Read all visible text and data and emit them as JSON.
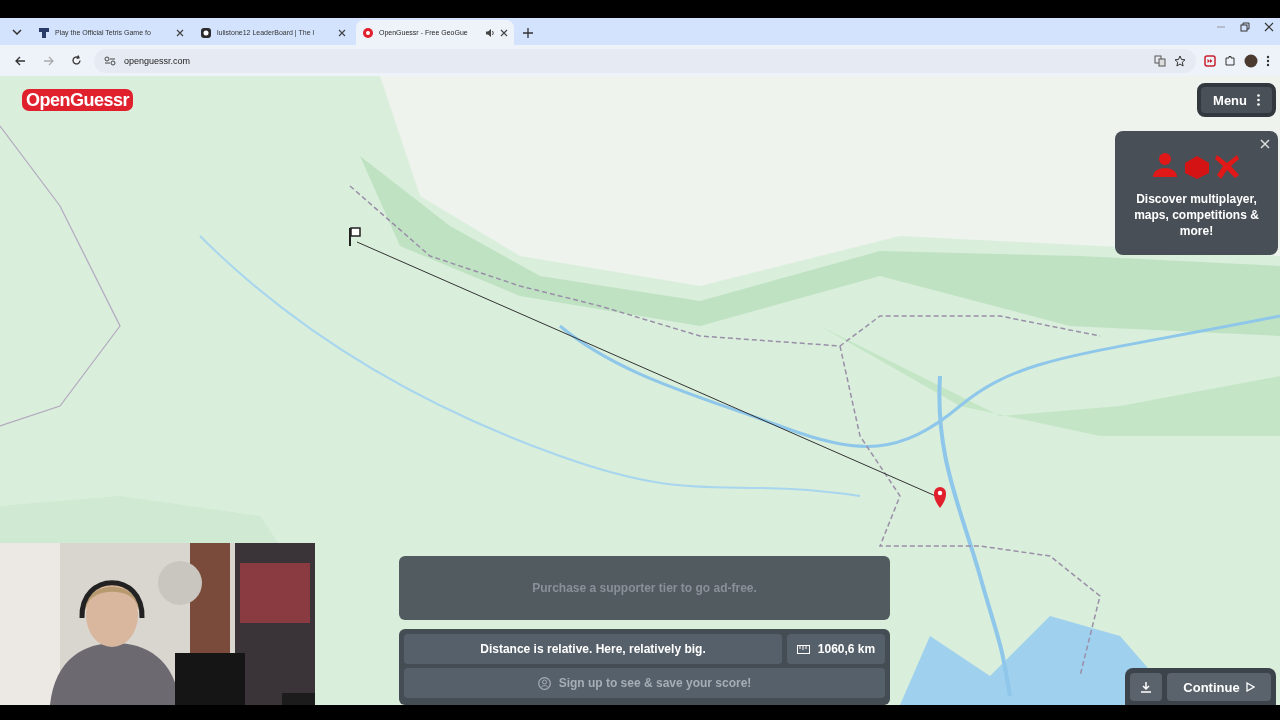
{
  "browser": {
    "tabs": [
      {
        "title": "Play the Official Tetris Game fo",
        "selected": false,
        "audio": false
      },
      {
        "title": "lulistone12 LeaderBoard | The l",
        "selected": false,
        "audio": false
      },
      {
        "title": "OpenGuessr - Free GeoGue",
        "selected": true,
        "audio": true
      }
    ],
    "url": "openguessr.com"
  },
  "game": {
    "logo": "OpenGuessr",
    "menu": "Menu",
    "promo": {
      "text": "Discover multiplayer, maps, competitions & more!"
    },
    "ad_notice": "Purchase a supporter tier to go ad-free.",
    "result": {
      "message": "Distance is relative. Here, relatively big.",
      "distance": "1060,6 km",
      "signup": "Sign up to see & save your score!"
    },
    "continue": "Continue"
  }
}
